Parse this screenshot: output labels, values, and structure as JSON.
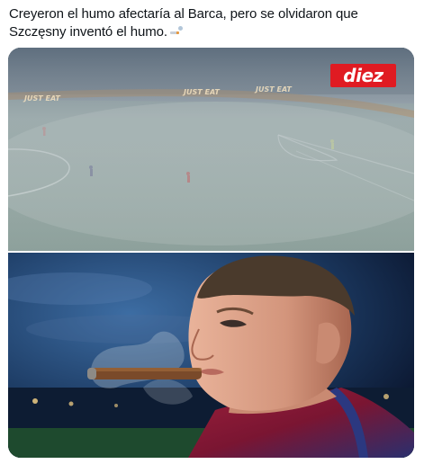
{
  "post": {
    "text": "Creyeron el humo afectaría al Barca, pero se olvidaron que Szczęsny inventó el humo."
  },
  "media": {
    "logo_text": "diez",
    "ad_board_text": "JUST EAT"
  },
  "colors": {
    "logo_background": "#e01b22",
    "pitch_haze": "#9fb0ae",
    "stadium_night": "#19375c"
  }
}
